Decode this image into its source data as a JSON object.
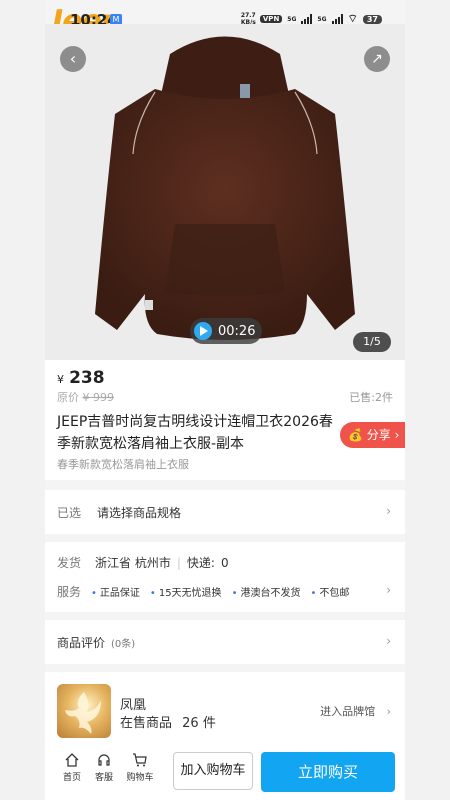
{
  "status": {
    "time": "10:24",
    "app_badge": "M",
    "net_speed": "27.7 KB/s",
    "vpn": "VPN",
    "sig1": "5G",
    "sig2": "5G",
    "battery": "37"
  },
  "logo": "Jeep",
  "gallery": {
    "video_time": "00:26",
    "counter": "1/5"
  },
  "product": {
    "currency": "¥",
    "price": "238",
    "orig_label": "原价",
    "orig_price": "¥ 999",
    "sold": "已售:2件",
    "title": "JEEP吉普时尚复古明线设计连帽卫衣2026春季新款宽松落肩袖上衣服-副本",
    "subtitle": "春季新款宽松落肩袖上衣服",
    "share": "分享"
  },
  "spec": {
    "label": "已选",
    "value": "请选择商品规格"
  },
  "shipping": {
    "label": "发货",
    "location": "浙江省 杭州市",
    "express_label": "快递:",
    "express_value": "0"
  },
  "service": {
    "label": "服务",
    "items": [
      "正品保证",
      "15天无忧退换",
      "港澳台不发货",
      "不包邮"
    ]
  },
  "review": {
    "label": "商品评价",
    "count": "(0条)"
  },
  "brand": {
    "name": "凤凰",
    "count_label": "在售商品",
    "count": "26",
    "count_unit": "件",
    "enter": "进入品牌馆"
  },
  "bottom": {
    "home": "首页",
    "service": "客服",
    "cart": "购物车",
    "add_cart": "加入购物车",
    "buy_now": "立即购买"
  },
  "colors": {
    "accent": "#12a5f2",
    "share": "#f0534a",
    "hoodie": "#4a2418"
  }
}
